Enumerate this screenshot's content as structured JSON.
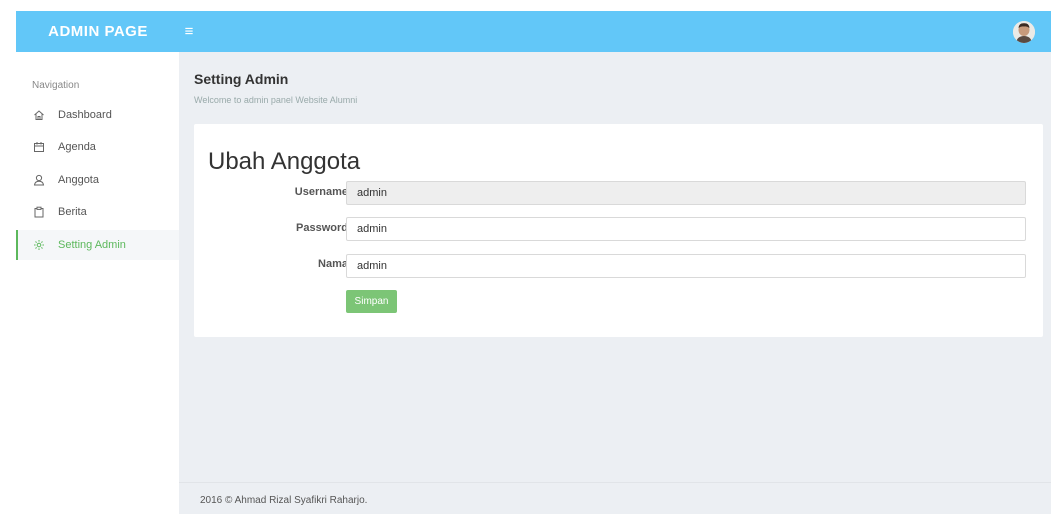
{
  "header": {
    "brand": "ADMIN PAGE",
    "toggle_icon": "≡"
  },
  "sidebar": {
    "title": "Navigation",
    "items": [
      {
        "label": "Dashboard",
        "icon": "home-icon"
      },
      {
        "label": "Agenda",
        "icon": "calendar-icon"
      },
      {
        "label": "Anggota",
        "icon": "user-icon"
      },
      {
        "label": "Berita",
        "icon": "clipboard-icon"
      },
      {
        "label": "Setting Admin",
        "icon": "gear-icon",
        "active": true
      }
    ]
  },
  "main": {
    "title": "Setting Admin",
    "subtitle": "Welcome to admin panel Website Alumni",
    "form": {
      "title": "Ubah Anggota",
      "fields": [
        {
          "label": "Username",
          "value": "admin",
          "disabled": true
        },
        {
          "label": "Password",
          "value": "admin"
        },
        {
          "label": "Nama",
          "value": "admin"
        }
      ],
      "submit_label": "Simpan"
    }
  },
  "footer": {
    "text": "2016 © Ahmad Rizal Syafikri Raharjo."
  },
  "colors": {
    "header": "#62c7f8",
    "active": "#5cb85c",
    "button": "#7cc576",
    "content_bg": "#eceff3"
  }
}
